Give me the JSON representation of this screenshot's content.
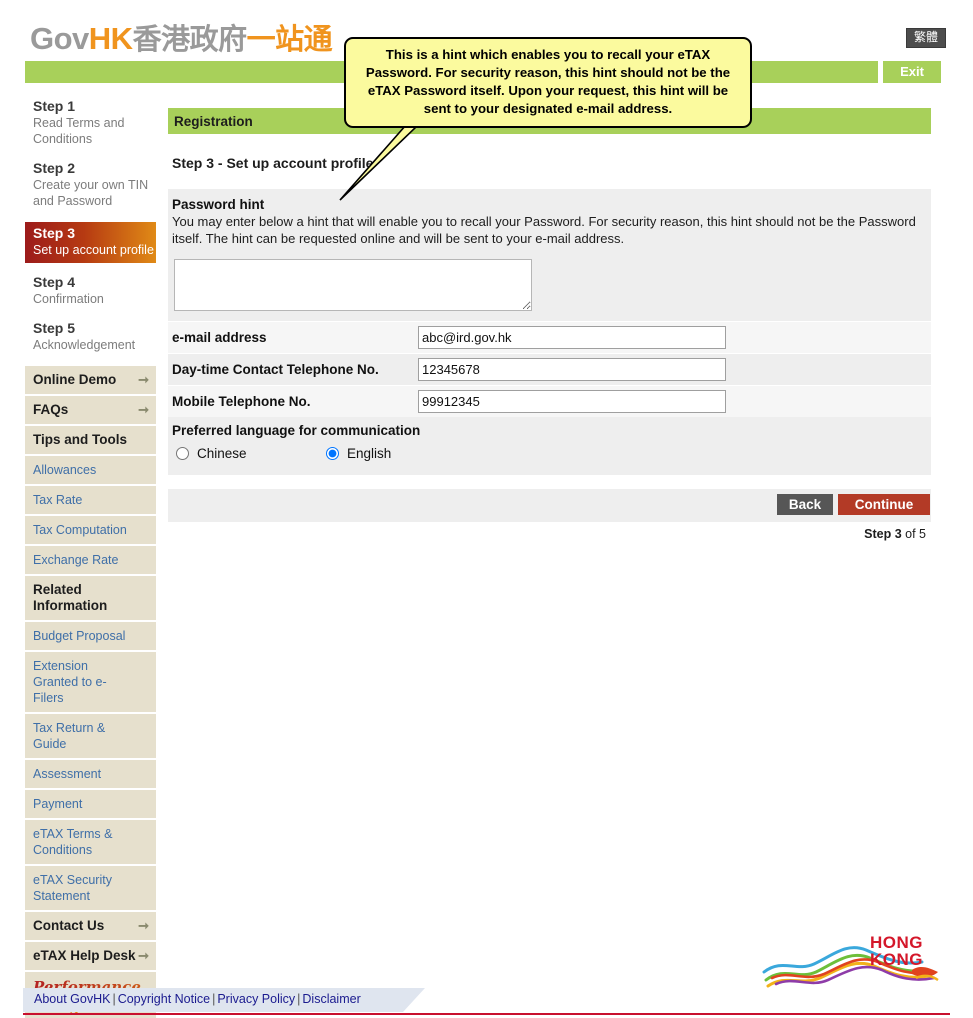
{
  "header": {
    "logo_gov": "Gov",
    "logo_hk": "HK",
    "logo_cn_gray": "香港政府",
    "logo_cn_orange": "一站通",
    "lang_switch": "繁體",
    "exit_label": "Exit"
  },
  "tooltip": {
    "text": "This is a hint which enables you to recall your eTAX Password. For security reason, this hint should not be the eTAX Password itself. Upon your request, this hint will be sent to your designated e-mail address."
  },
  "sidebar": {
    "steps": [
      {
        "title": "Step 1",
        "sub": "Read Terms and Conditions",
        "active": false
      },
      {
        "title": "Step 2",
        "sub": "Create your own TIN and Password",
        "active": false
      },
      {
        "title": "Step 3",
        "sub": "Set up account profile",
        "active": true
      },
      {
        "title": "Step 4",
        "sub": "Confirmation",
        "active": false
      },
      {
        "title": "Step 5",
        "sub": "Acknowledgement",
        "active": false
      }
    ],
    "items": [
      {
        "label": "Online Demo",
        "type": "head",
        "arrow": true
      },
      {
        "label": "FAQs",
        "type": "head",
        "arrow": true
      },
      {
        "label": "Tips and Tools",
        "type": "head",
        "arrow": false
      },
      {
        "label": "Allowances",
        "type": "link",
        "arrow": false
      },
      {
        "label": "Tax Rate",
        "type": "link",
        "arrow": false
      },
      {
        "label": "Tax Computation",
        "type": "link",
        "arrow": false
      },
      {
        "label": "Exchange Rate",
        "type": "link",
        "arrow": false
      },
      {
        "label": "Related Information",
        "type": "head",
        "arrow": false
      },
      {
        "label": "Budget Proposal",
        "type": "link",
        "arrow": false
      },
      {
        "label": "Extension Granted to e-Filers",
        "type": "link",
        "arrow": false
      },
      {
        "label": "Tax Return & Guide",
        "type": "link",
        "arrow": false
      },
      {
        "label": "Assessment",
        "type": "link",
        "arrow": false
      },
      {
        "label": "Payment",
        "type": "link",
        "arrow": false
      },
      {
        "label": "eTAX Terms & Conditions",
        "type": "link",
        "arrow": false
      },
      {
        "label": "eTAX Security Statement",
        "type": "link",
        "arrow": false
      },
      {
        "label": "Contact Us",
        "type": "head",
        "arrow": true
      },
      {
        "label": "eTAX Help Desk",
        "type": "head",
        "arrow": true
      },
      {
        "label": "Performance Pledge",
        "type": "pledge",
        "arrow": true
      }
    ]
  },
  "main": {
    "section_title": "Registration",
    "step_heading": "Step 3 - Set up account profile",
    "password_hint": {
      "title": "Password hint",
      "description": "You may enter below a hint that will enable you to recall your Password. For security reason, this hint should not be the Password itself. The hint can be requested online and will be sent to your e-mail address.",
      "value": ""
    },
    "fields": [
      {
        "label": "e-mail address",
        "value": "abc@ird.gov.hk"
      },
      {
        "label": "Day-time Contact Telephone No.",
        "value": "12345678"
      },
      {
        "label": "Mobile Telephone No.",
        "value": "99912345"
      }
    ],
    "language": {
      "label": "Preferred language for communication",
      "options": [
        {
          "label": "Chinese",
          "selected": false
        },
        {
          "label": "English",
          "selected": true
        }
      ]
    },
    "buttons": {
      "back": "Back",
      "continue": "Continue"
    },
    "step_counter": {
      "prefix": "Step ",
      "current": "3",
      "suffix": " of 5"
    }
  },
  "footer": {
    "links": [
      "About GovHK",
      "Copyright Notice",
      "Privacy Policy",
      "Disclaimer"
    ],
    "separator": "|",
    "brand_line1": "HONG",
    "brand_line2": "KONG"
  },
  "colors": {
    "green": "#a8d05a",
    "accent_orange": "#f0941e",
    "brand_red": "#c8102e",
    "continue_red": "#b33a26",
    "tooltip_yellow": "#fbfa9e"
  }
}
